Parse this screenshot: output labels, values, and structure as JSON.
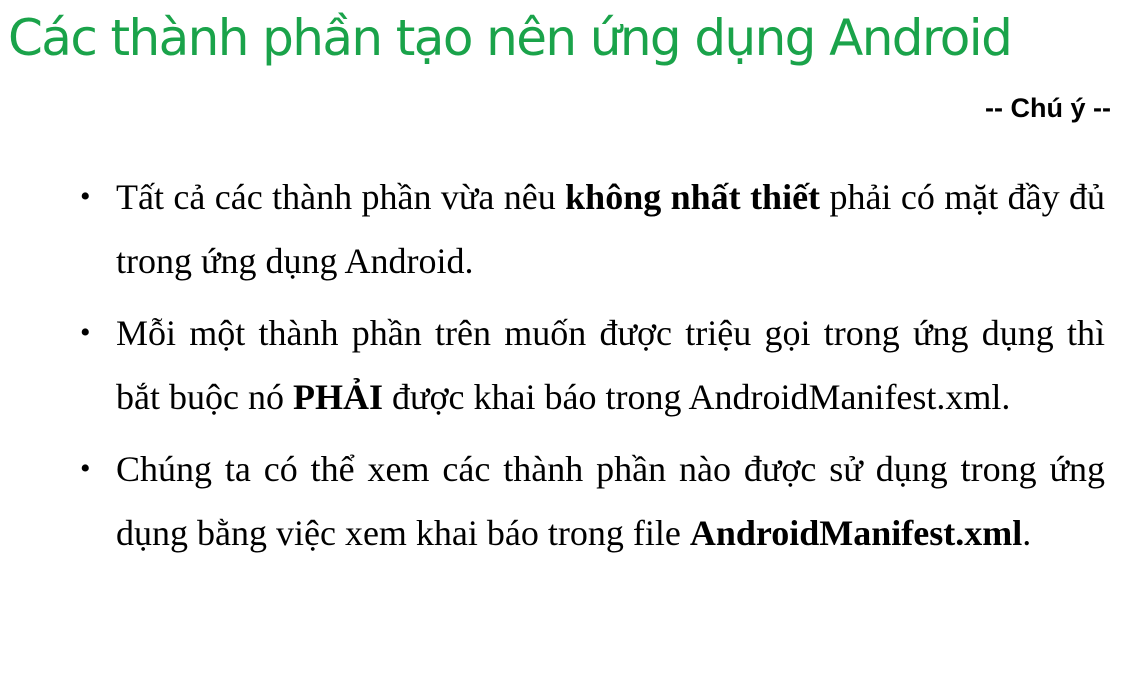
{
  "slide": {
    "title": "Các thành phần tạo nên ứng dụng Android",
    "subtitle": "-- Chú ý --",
    "bullet_symbol": "•",
    "bullets": [
      {
        "parts": [
          {
            "text": "Tất cả các thành phần vừa nêu ",
            "bold": false
          },
          {
            "text": "không nhất thiết",
            "bold": true
          },
          {
            "text": " phải có mặt đầy đủ trong ứng dụng Android.",
            "bold": false
          }
        ]
      },
      {
        "parts": [
          {
            "text": "Mỗi một thành phần trên muốn được triệu gọi trong ứng dụng thì bắt buộc nó ",
            "bold": false
          },
          {
            "text": "PHẢI",
            "bold": true
          },
          {
            "text": " được khai báo trong AndroidManifest.xml.",
            "bold": false
          }
        ]
      },
      {
        "parts": [
          {
            "text": "Chúng ta có thể xem các thành phần nào được sử dụng trong ứng dụng bằng việc xem khai báo trong file ",
            "bold": false
          },
          {
            "text": "AndroidManifest.xml",
            "bold": true
          },
          {
            "text": ".",
            "bold": false
          }
        ]
      }
    ]
  }
}
